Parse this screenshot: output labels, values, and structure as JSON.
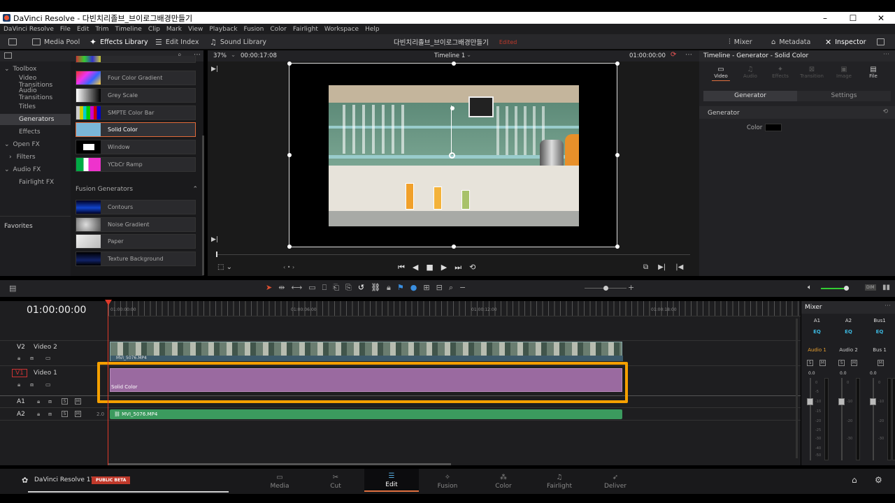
{
  "window": {
    "title": "DaVinci Resolve - 다빈치리졸브_브이로그배경만들기"
  },
  "menu": [
    "DaVinci Resolve",
    "File",
    "Edit",
    "Trim",
    "Timeline",
    "Clip",
    "Mark",
    "View",
    "Playback",
    "Fusion",
    "Color",
    "Fairlight",
    "Workspace",
    "Help"
  ],
  "toolbar": {
    "media_pool": "Media Pool",
    "effects_library": "Effects Library",
    "edit_index": "Edit Index",
    "sound_library": "Sound Library",
    "project_title": "다빈치리졸브_브이로그배경만들기",
    "edited": "Edited",
    "mixer": "Mixer",
    "metadata": "Metadata",
    "inspector": "Inspector"
  },
  "toolbox": {
    "items": [
      "Toolbox",
      "Video Transitions",
      "Audio Transitions",
      "Titles",
      "Generators",
      "Effects",
      "Open FX",
      "Filters",
      "Audio FX",
      "Fairlight FX"
    ],
    "selected": "Generators",
    "favorites": "Favorites"
  },
  "effects": {
    "generators": [
      "Four Color Gradient",
      "Grey Scale",
      "SMPTE Color Bar",
      "Solid Color",
      "Window",
      "YCbCr Ramp"
    ],
    "selected": "Solid Color",
    "fusion_header": "Fusion Generators",
    "fusion": [
      "Contours",
      "Noise Gradient",
      "Paper",
      "Texture Background"
    ]
  },
  "viewer": {
    "zoom": "37%",
    "timecode": "00:00:17:08",
    "timeline_name": "Timeline 1",
    "current_tc": "01:00:00:00"
  },
  "inspector": {
    "header": "Timeline - Generator - Solid Color",
    "tabs": [
      "Video",
      "Audio",
      "Effects",
      "Transition",
      "Image",
      "File"
    ],
    "subtabs": [
      "Generator",
      "Settings"
    ],
    "section": "Generator",
    "color_label": "Color",
    "color_value": "#000000"
  },
  "timeline": {
    "timecode": "01:00:00:00",
    "ruler": [
      "01:00:00:00",
      "01:00:06:00",
      "01:00:12:00",
      "01:00:18:00"
    ],
    "tracks": [
      {
        "id": "V2",
        "name": "Video 2"
      },
      {
        "id": "V1",
        "name": "Video 1"
      },
      {
        "id": "A1",
        "name": ""
      },
      {
        "id": "A2",
        "name": "",
        "level": "2.0"
      }
    ],
    "clips": {
      "v2": "MVI_5076.MP4",
      "v1": "Solid Color",
      "a2": "MVI_5076.MP4"
    }
  },
  "mixer": {
    "title": "Mixer",
    "channels": [
      "A1",
      "A2",
      "Bus1"
    ],
    "eq": "EQ",
    "names": [
      "Audio 1",
      "Audio 2",
      "Bus 1"
    ],
    "values": [
      "0.0",
      "0.0",
      "0.0"
    ],
    "scale": [
      "0",
      "-5",
      "-10",
      "-15",
      "-20",
      "-25",
      "-30",
      "-40",
      "-50"
    ]
  },
  "pages": [
    "Media",
    "Cut",
    "Edit",
    "Fusion",
    "Color",
    "Fairlight",
    "Deliver"
  ],
  "selected_page": "Edit",
  "product": {
    "name": "DaVinci Resolve 17",
    "badge": "PUBLIC BETA"
  },
  "colors": {
    "accent": "#e07040",
    "highlight": "#f5a000",
    "purple_clip": "#9a6aa0",
    "green_clip": "#3b9a5e"
  }
}
